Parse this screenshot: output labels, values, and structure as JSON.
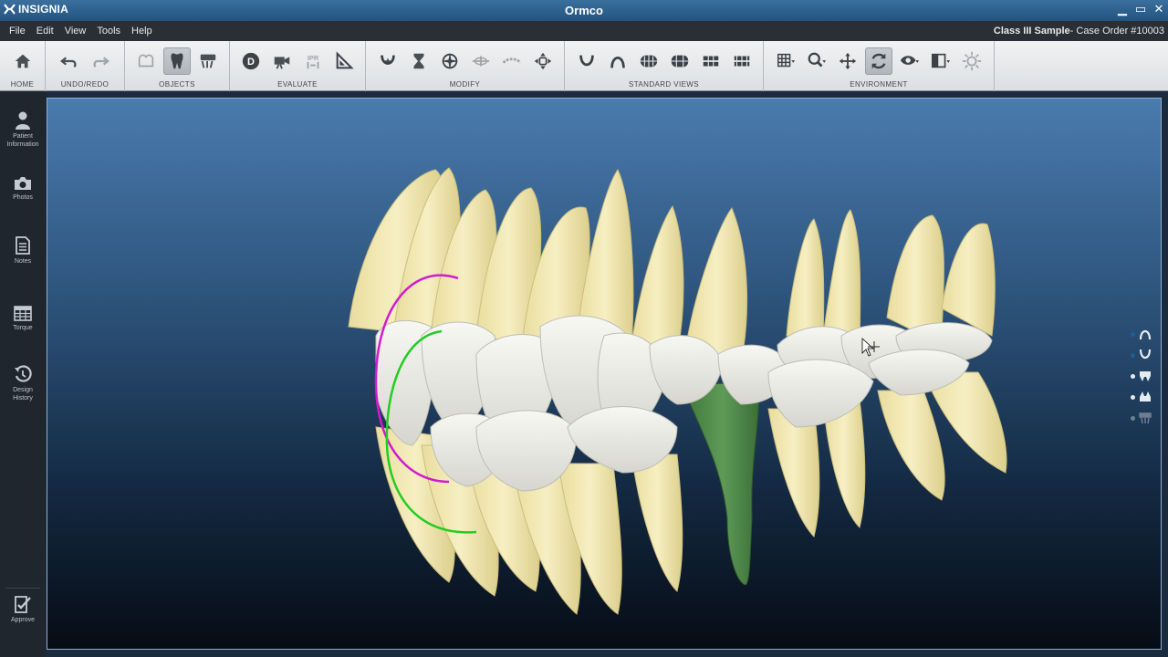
{
  "window": {
    "brand": "INSIGNIA",
    "title": "Ormco"
  },
  "menu": [
    "File",
    "Edit",
    "View",
    "Tools",
    "Help"
  ],
  "case": {
    "name": "Class III Sample",
    "suffix": "- Case Order #10003"
  },
  "ribbon_groups": {
    "home": "HOME",
    "undo_redo": "UNDO/REDO",
    "objects": "OBJECTS",
    "evaluate": "EVALUATE",
    "modify": "MODIFY",
    "standard_views": "STANDARD VIEWS",
    "environment": "ENVIRONMENT"
  },
  "toolbar_text": {
    "d_label": "D",
    "ipr_label": "IPR"
  },
  "sidebar": {
    "patient_info": "Patient Information",
    "photos": "Photos",
    "notes": "Notes",
    "torque": "Torque",
    "design_history": "Design History",
    "approve": "Approve"
  },
  "colors": {
    "titlebar": "#23547f",
    "ring_magenta": "#d21ad0",
    "ring_green": "#22cc22",
    "tooth_root": "#f2e9b4",
    "tooth_crown": "#ecebe6",
    "highlight_tooth": "#4e8a4a"
  }
}
